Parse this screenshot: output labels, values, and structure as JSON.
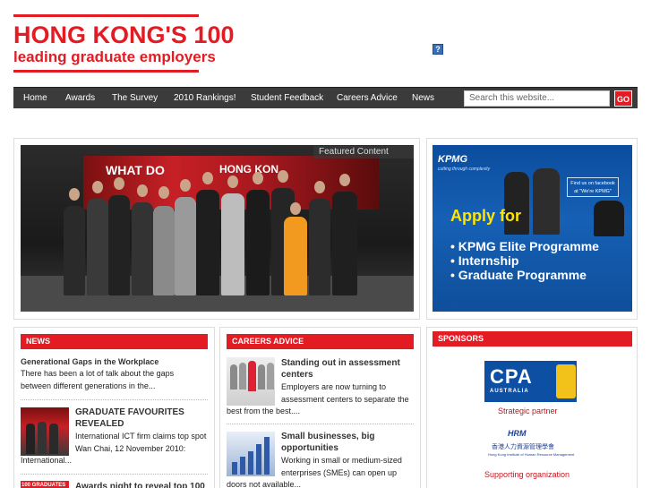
{
  "header": {
    "logo_line1": "HONG KONG'S 100",
    "logo_line2": "leading graduate employers",
    "help_icon": "?"
  },
  "nav": {
    "items": [
      "Home",
      "Awards",
      "The Survey",
      "2010 Rankings!",
      "Student Feedback",
      "Careers Advice",
      "News"
    ],
    "search_placeholder": "Search this website...",
    "go_label": "GO"
  },
  "featured": {
    "label": "Featured Content",
    "banner_text_1": "WHAT DO",
    "banner_text_2": "HONG KON"
  },
  "kpmg_ad": {
    "brand": "KPMG",
    "tagline": "cutting through complexity",
    "facebook_line1": "Find us on facebook",
    "facebook_line2": "at \"We're KPMG\"",
    "apply": "Apply for",
    "programmes": [
      "• KPMG Elite Programme",
      "• Internship",
      "• Graduate Programme"
    ]
  },
  "news": {
    "heading": "NEWS",
    "item1_title": "Generational Gaps in the Workplace",
    "item1_body_1": "There has been a lot of talk about the gaps",
    "item1_body_2": "between different generations in the...",
    "item2_title_1": "GRADUATE FAVOURITES",
    "item2_title_2": "REVEALED",
    "item2_body_1": "International ICT firm claims top spot",
    "item2_body_2": "Wan Chai, 12 November 2010:",
    "item2_body_3": "International...",
    "item3_thumb_text": "100 GRADUATES",
    "item3_title": "Awards night to reveal top 100"
  },
  "careers": {
    "heading": "CAREERS ADVICE",
    "item1_title_1": "Standing out in assessment",
    "item1_title_2": "centers",
    "item1_body_1": "Employers are now turning to",
    "item1_body_2": "assessment centers to separate the",
    "item1_body_3": "best from the best....",
    "item2_title_1": "Small businesses, big",
    "item2_title_2": "opportunities",
    "item2_body_1": "Working in small or medium-sized",
    "item2_body_2": "enterprises (SMEs) can open up",
    "item2_body_3": "doors not available..."
  },
  "sponsors": {
    "heading": "SPONSORS",
    "cpa_text": "CPA",
    "cpa_sub": "AUSTRALIA",
    "strategic_label": "Strategic partner",
    "hrm_text": "HRM",
    "hrm_chinese": "香港人力資源管理學會",
    "hrm_english": "Hong Kong Institute of Human Resource Management",
    "supporting_label": "Supporting organization"
  },
  "colors": {
    "brand_red": "#e31b23",
    "nav_bg": "#3b3b3b",
    "kpmg_blue": "#0b4d9e",
    "apply_yellow": "#ffe500"
  }
}
